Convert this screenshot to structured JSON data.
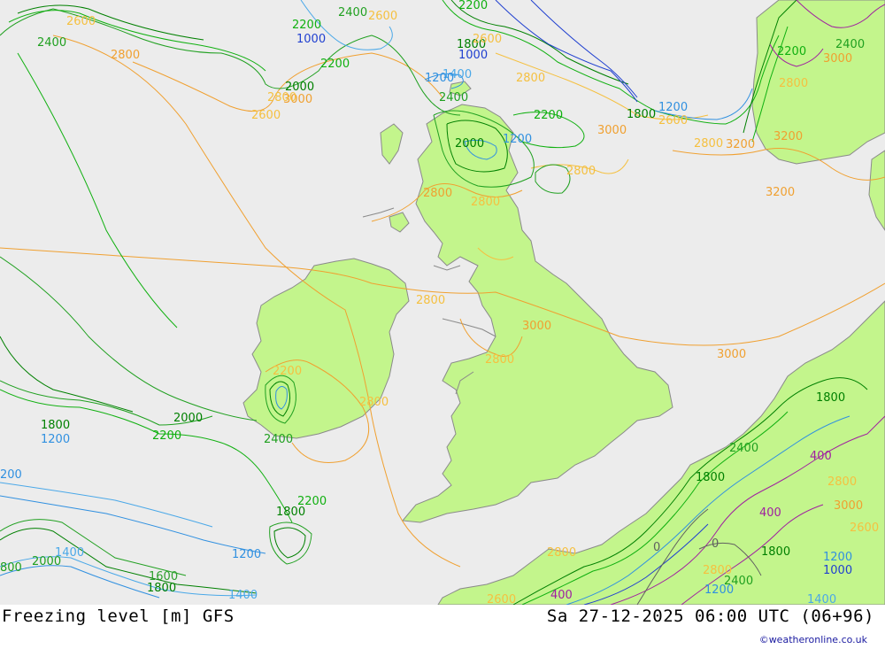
{
  "footer": {
    "title": "Freezing level [m] GFS",
    "datetime": "Sa 27-12-2025 06:00 UTC (06+96)",
    "credit": "©weatheronline.co.uk"
  },
  "colors": {
    "sea": "#ececec",
    "land": "#c3f58c",
    "coast": "#8a8a8a",
    "c3200": "#f0a030",
    "c3000": "#f0a030",
    "c2800": "#f5c040",
    "c2400": "#20a020",
    "c2200": "#20b020",
    "c2000": "#10c010",
    "c1800": "#008000",
    "c1600": "#30a030",
    "c1400": "#4aa8e8",
    "c1200": "#3090e0",
    "c1000": "#2040d0",
    "c400": "#a020a0",
    "c0": "#606060"
  },
  "contour_labels": {
    "l2600_tl": "2600",
    "l2400_tl": "2400",
    "l2800_tl": "2800",
    "l2200_n": "2200",
    "l2400_n": "2400",
    "l2600_n": "2600",
    "l1000_n": "1000",
    "l2200_n2": "2200",
    "l2000_n": "2000",
    "l3000_n": "3000",
    "l2800_n": "2800",
    "l2600_n2": "2600",
    "l2200_ne": "2200",
    "l1800_ne": "1800",
    "l1000_ne": "1000",
    "l2600_ne": "2600",
    "l1400_n": "1400",
    "l1200_n": "1200",
    "l2800_ne": "2800",
    "l2400_sc": "2400",
    "l2000_sc": "2000",
    "l1200_sc": "1200",
    "l2200_sc": "2200",
    "l3000_sc": "3000",
    "l2800_sc": "2800",
    "l2800_sc2": "2800",
    "l1200_nor": "1200",
    "l1800_nor": "1800",
    "l2600_nor": "2600",
    "l2800_nor": "2800",
    "l3200_nor": "3200",
    "l3200_nor2": "3200",
    "l3200_nor3": "3200",
    "l2200_sw": "2200",
    "l3000_sw": "3000",
    "l2800_sw": "2800",
    "l2400_sw": "2400",
    "l2800_ir": "2800",
    "l2800_ir2": "2800",
    "l2800_mid": "2800",
    "l3000_eng": "3000",
    "l3000_ns": "3000",
    "l2800_ie": "2800",
    "l2200_ie": "2200",
    "l2400_ie": "2400",
    "l1800_w": "1800",
    "l1200_w": "1200",
    "l2000_w": "2000",
    "l2200_w": "2200",
    "l200_w": "200",
    "l1800_sw": "1800",
    "l2200_sw2": "2200",
    "l1400_sw": "1400",
    "l2000_sw": "2000",
    "l800_sw": "800",
    "l1600_sw": "1600",
    "l1800_sw2": "1800",
    "l1200_sw2": "1200",
    "l1400_sw2": "1400",
    "l1800_be": "1800",
    "l2400_fr": "2400",
    "l400_fr": "400",
    "l1800_fr": "1800",
    "l2800_fr": "2800",
    "l3000_fr": "3000",
    "l2600_fr": "2600",
    "l400_fr2": "400",
    "l0_fr": "0",
    "l0_fr2": "0",
    "l1800_fr2": "1800",
    "l1200_fr": "1200",
    "l1000_fr": "1000",
    "l2800_fr2": "2800",
    "l2400_fr2": "2400",
    "l1200_fr2": "1200",
    "l1400_fr": "1400",
    "l2600_bot": "2600",
    "l400_bot": "400",
    "l2800_bot": "2800"
  }
}
